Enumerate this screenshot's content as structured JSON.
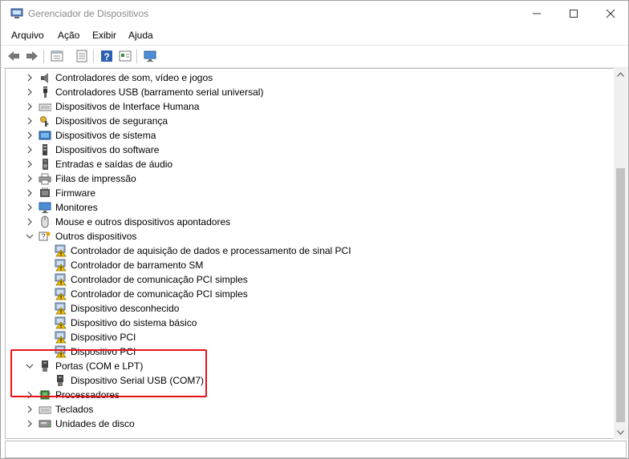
{
  "window": {
    "title": "Gerenciador de Dispositivos"
  },
  "menu": [
    "Arquivo",
    "Ação",
    "Exibir",
    "Ajuda"
  ],
  "toolbar": [
    "back-icon",
    "forward-icon",
    "properties-icon",
    "update-icon",
    "help-icon",
    "view-icon",
    "monitor-icon"
  ],
  "tree": [
    {
      "label": "Controladores de som, vídeo e jogos",
      "level": 0,
      "state": "collapsed",
      "icon": "sound-icon"
    },
    {
      "label": "Controladores USB (barramento serial universal)",
      "level": 0,
      "state": "collapsed",
      "icon": "usb-icon"
    },
    {
      "label": "Dispositivos de Interface Humana",
      "level": 0,
      "state": "collapsed",
      "icon": "keyboard-icon"
    },
    {
      "label": "Dispositivos de segurança",
      "level": 0,
      "state": "collapsed",
      "icon": "key-icon"
    },
    {
      "label": "Dispositivos de sistema",
      "level": 0,
      "state": "collapsed",
      "icon": "system-icon"
    },
    {
      "label": "Dispositivos do software",
      "level": 0,
      "state": "collapsed",
      "icon": "software-icon"
    },
    {
      "label": "Entradas e saídas de áudio",
      "level": 0,
      "state": "collapsed",
      "icon": "speaker-icon"
    },
    {
      "label": "Filas de impressão",
      "level": 0,
      "state": "collapsed",
      "icon": "printer-icon"
    },
    {
      "label": "Firmware",
      "level": 0,
      "state": "collapsed",
      "icon": "firmware-icon"
    },
    {
      "label": "Monitores",
      "level": 0,
      "state": "collapsed",
      "icon": "monitor-icon"
    },
    {
      "label": "Mouse e outros dispositivos apontadores",
      "level": 0,
      "state": "collapsed",
      "icon": "mouse-icon"
    },
    {
      "label": "Outros dispositivos",
      "level": 0,
      "state": "expanded",
      "icon": "unknown-device-icon"
    },
    {
      "label": "Controlador de aquisição de dados e processamento de sinal PCI",
      "level": 1,
      "icon": "warning-device-icon"
    },
    {
      "label": "Controlador de barramento SM",
      "level": 1,
      "icon": "warning-device-icon"
    },
    {
      "label": "Controlador de comunicação PCI simples",
      "level": 1,
      "icon": "warning-device-icon"
    },
    {
      "label": "Controlador de comunicação PCI simples",
      "level": 1,
      "icon": "warning-device-icon"
    },
    {
      "label": "Dispositivo desconhecido",
      "level": 1,
      "icon": "warning-device-icon"
    },
    {
      "label": "Dispositivo do sistema básico",
      "level": 1,
      "icon": "warning-device-icon"
    },
    {
      "label": "Dispositivo PCI",
      "level": 1,
      "icon": "warning-device-icon"
    },
    {
      "label": "Dispositivo PCI",
      "level": 1,
      "icon": "warning-device-icon"
    },
    {
      "label": "Portas (COM e LPT)",
      "level": 0,
      "state": "expanded",
      "icon": "port-icon"
    },
    {
      "label": "Dispositivo Serial USB (COM7)",
      "level": 1,
      "icon": "port-icon"
    },
    {
      "label": "Processadores",
      "level": 0,
      "state": "collapsed",
      "icon": "cpu-icon"
    },
    {
      "label": "Teclados",
      "level": 0,
      "state": "collapsed",
      "icon": "keyboard-icon"
    },
    {
      "label": "Unidades de disco",
      "level": 0,
      "state": "collapsed",
      "icon": "disk-icon"
    }
  ],
  "colors": {
    "highlight": "#e8121b",
    "title_text": "#8a8a8a"
  }
}
